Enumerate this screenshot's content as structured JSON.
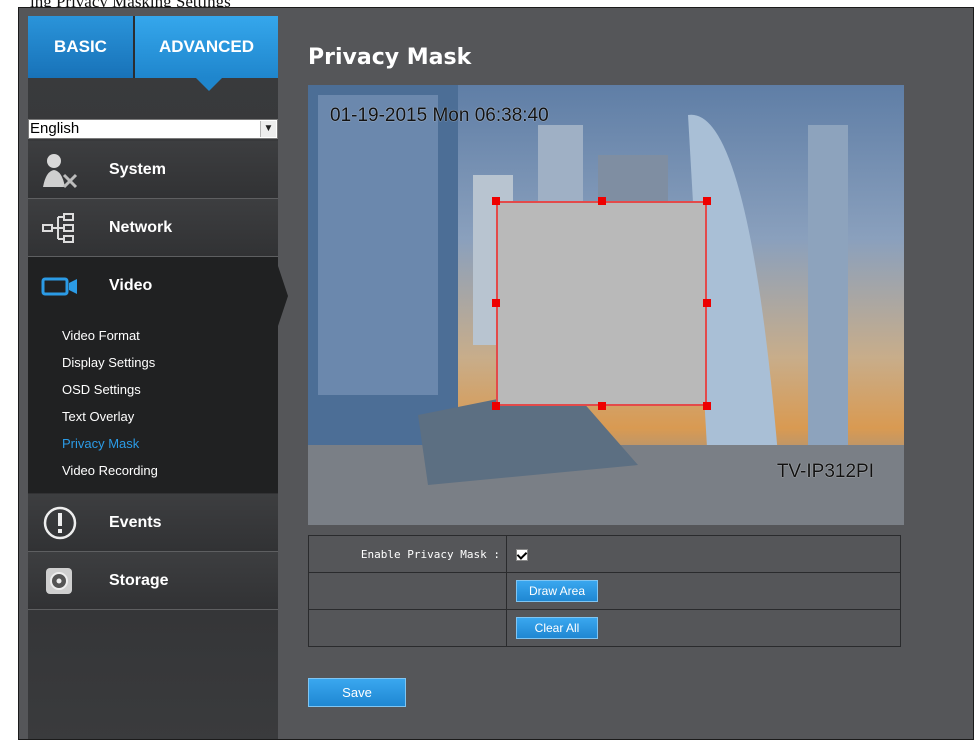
{
  "header_fragment": "ing Privacy Masking Settings",
  "tabs": {
    "basic": "BASIC",
    "advanced": "ADVANCED"
  },
  "language": {
    "selected": "English"
  },
  "nav": {
    "system": "System",
    "network": "Network",
    "video": "Video",
    "events": "Events",
    "storage": "Storage"
  },
  "submenu": [
    {
      "label": "Video Format",
      "active": false
    },
    {
      "label": "Display Settings",
      "active": false
    },
    {
      "label": "OSD Settings",
      "active": false
    },
    {
      "label": "Text Overlay",
      "active": false
    },
    {
      "label": "Privacy Mask",
      "active": true
    },
    {
      "label": "Video Recording",
      "active": false
    }
  ],
  "page": {
    "title": "Privacy Mask"
  },
  "camera": {
    "timestamp": "01-19-2015 Mon  06:38:40",
    "device_name": "TV-IP312PI"
  },
  "form": {
    "enable_label": "Enable Privacy Mask :",
    "enable_checked": true,
    "draw_area": "Draw Area",
    "clear_all": "Clear All",
    "save": "Save"
  },
  "colors": {
    "accent": "#1f87d2",
    "active_submenu": "#2b9be6",
    "mask_border": "#e34a4a",
    "mask_fill": "#b9b9b9"
  }
}
